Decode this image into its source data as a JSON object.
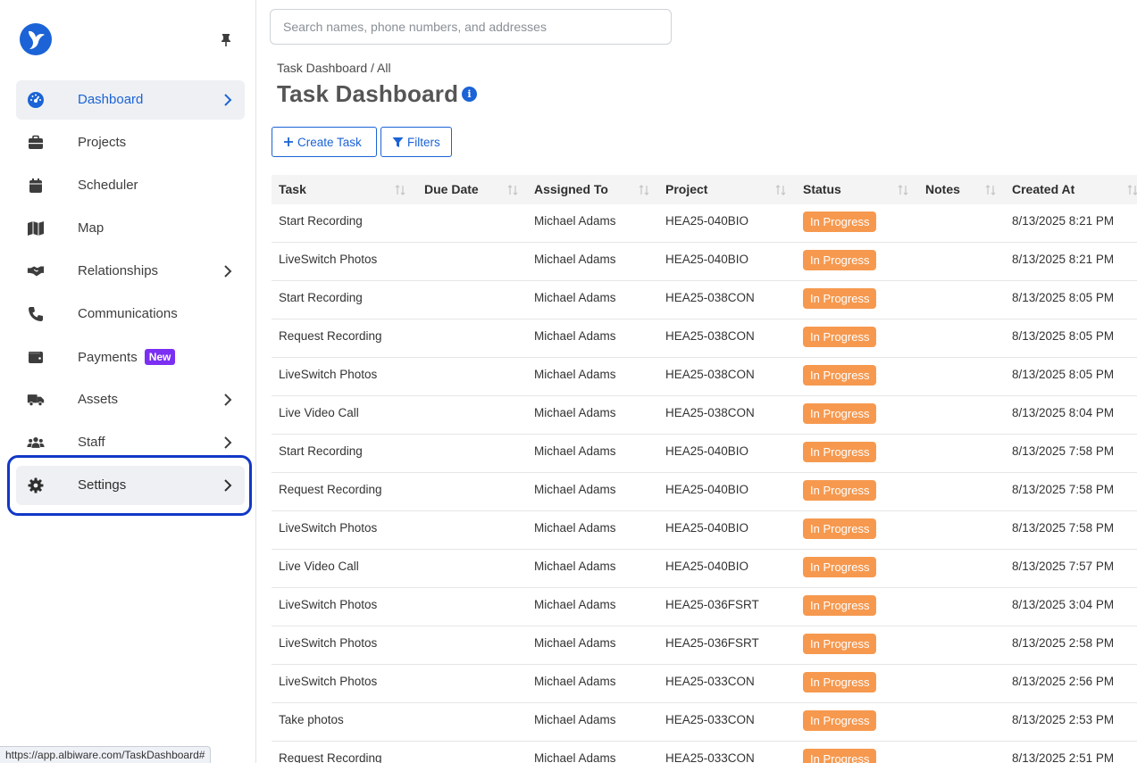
{
  "sidebar": {
    "items": [
      {
        "label": "Dashboard",
        "icon": "gauge-icon",
        "active": true,
        "chevron": true
      },
      {
        "label": "Projects",
        "icon": "briefcase-icon",
        "chevron": false
      },
      {
        "label": "Scheduler",
        "icon": "calendar-icon",
        "chevron": false
      },
      {
        "label": "Map",
        "icon": "map-icon",
        "chevron": false
      },
      {
        "label": "Relationships",
        "icon": "handshake-icon",
        "chevron": true
      },
      {
        "label": "Communications",
        "icon": "phone-icon",
        "chevron": false
      },
      {
        "label": "Payments",
        "icon": "wallet-icon",
        "chevron": false,
        "badge": "New"
      },
      {
        "label": "Assets",
        "icon": "truck-icon",
        "chevron": true
      },
      {
        "label": "Staff",
        "icon": "users-icon",
        "chevron": true
      },
      {
        "label": "Settings",
        "icon": "gear-icon",
        "chevron": true,
        "hovered": true
      }
    ]
  },
  "search": {
    "placeholder": "Search names, phone numbers, and addresses",
    "value": ""
  },
  "header": {
    "breadcrumb": "Task Dashboard / All",
    "title": "Task Dashboard",
    "info_glyph": "i"
  },
  "toolbar": {
    "create_label": "Create Task",
    "filters_label": "Filters"
  },
  "table": {
    "columns": [
      "Task",
      "Due Date",
      "Assigned To",
      "Project",
      "Status",
      "Notes",
      "Created At"
    ],
    "rows": [
      {
        "task": "Start Recording",
        "due": "",
        "assigned": "Michael Adams",
        "project": "HEA25-040BIO",
        "status": "In Progress",
        "notes": "",
        "created": "8/13/2025 8:21 PM"
      },
      {
        "task": "LiveSwitch Photos",
        "due": "",
        "assigned": "Michael Adams",
        "project": "HEA25-040BIO",
        "status": "In Progress",
        "notes": "",
        "created": "8/13/2025 8:21 PM"
      },
      {
        "task": "Start Recording",
        "due": "",
        "assigned": "Michael Adams",
        "project": "HEA25-038CON",
        "status": "In Progress",
        "notes": "",
        "created": "8/13/2025 8:05 PM"
      },
      {
        "task": "Request Recording",
        "due": "",
        "assigned": "Michael Adams",
        "project": "HEA25-038CON",
        "status": "In Progress",
        "notes": "",
        "created": "8/13/2025 8:05 PM"
      },
      {
        "task": "LiveSwitch Photos",
        "due": "",
        "assigned": "Michael Adams",
        "project": "HEA25-038CON",
        "status": "In Progress",
        "notes": "",
        "created": "8/13/2025 8:05 PM"
      },
      {
        "task": "Live Video Call",
        "due": "",
        "assigned": "Michael Adams",
        "project": "HEA25-038CON",
        "status": "In Progress",
        "notes": "",
        "created": "8/13/2025 8:04 PM"
      },
      {
        "task": "Start Recording",
        "due": "",
        "assigned": "Michael Adams",
        "project": "HEA25-040BIO",
        "status": "In Progress",
        "notes": "",
        "created": "8/13/2025 7:58 PM"
      },
      {
        "task": "Request Recording",
        "due": "",
        "assigned": "Michael Adams",
        "project": "HEA25-040BIO",
        "status": "In Progress",
        "notes": "",
        "created": "8/13/2025 7:58 PM"
      },
      {
        "task": "LiveSwitch Photos",
        "due": "",
        "assigned": "Michael Adams",
        "project": "HEA25-040BIO",
        "status": "In Progress",
        "notes": "",
        "created": "8/13/2025 7:58 PM"
      },
      {
        "task": "Live Video Call",
        "due": "",
        "assigned": "Michael Adams",
        "project": "HEA25-040BIO",
        "status": "In Progress",
        "notes": "",
        "created": "8/13/2025 7:57 PM"
      },
      {
        "task": "LiveSwitch Photos",
        "due": "",
        "assigned": "Michael Adams",
        "project": "HEA25-036FSRT",
        "status": "In Progress",
        "notes": "",
        "created": "8/13/2025 3:04 PM"
      },
      {
        "task": "LiveSwitch Photos",
        "due": "",
        "assigned": "Michael Adams",
        "project": "HEA25-036FSRT",
        "status": "In Progress",
        "notes": "",
        "created": "8/13/2025 2:58 PM"
      },
      {
        "task": "LiveSwitch Photos",
        "due": "",
        "assigned": "Michael Adams",
        "project": "HEA25-033CON",
        "status": "In Progress",
        "notes": "",
        "created": "8/13/2025 2:56 PM"
      },
      {
        "task": "Take photos",
        "due": "",
        "assigned": "Michael Adams",
        "project": "HEA25-033CON",
        "status": "In Progress",
        "notes": "",
        "created": "8/13/2025 2:53 PM"
      },
      {
        "task": "Request Recording",
        "due": "",
        "assigned": "Michael Adams",
        "project": "HEA25-033CON",
        "status": "In Progress",
        "notes": "",
        "created": "8/13/2025 2:51 PM"
      }
    ]
  },
  "statusbar": {
    "url": "https://app.albiware.com/TaskDashboard#"
  },
  "colors": {
    "accent": "#1b63d6",
    "status_in_progress": "#f6994f",
    "badge_new": "#7b2ff2",
    "focus_ring": "#1238c7"
  }
}
